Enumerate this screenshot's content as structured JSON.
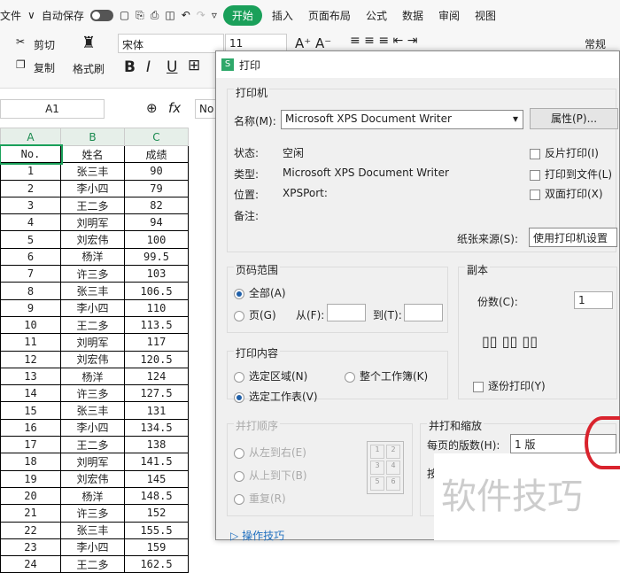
{
  "menubar": {
    "file": "文件",
    "autosave": "自动保存",
    "tabs": [
      "开始",
      "插入",
      "页面布局",
      "公式",
      "数据",
      "审阅",
      "视图"
    ]
  },
  "ribbon": {
    "cut": "剪切",
    "copy": "复制",
    "format_painter": "格式刷",
    "font": "宋体",
    "font_size": "11",
    "number_format": "常规"
  },
  "formula": {
    "cell_ref": "A1",
    "fx": "fx",
    "value": "No"
  },
  "sheet": {
    "columns": [
      "A",
      "B",
      "C"
    ],
    "rows": [
      [
        "No.",
        "姓名",
        "成绩"
      ],
      [
        "1",
        "张三丰",
        "90"
      ],
      [
        "2",
        "李小四",
        "79"
      ],
      [
        "3",
        "王二多",
        "82"
      ],
      [
        "4",
        "刘明军",
        "94"
      ],
      [
        "5",
        "刘宏伟",
        "100"
      ],
      [
        "6",
        "杨洋",
        "99.5"
      ],
      [
        "7",
        "许三多",
        "103"
      ],
      [
        "8",
        "张三丰",
        "106.5"
      ],
      [
        "9",
        "李小四",
        "110"
      ],
      [
        "10",
        "王二多",
        "113.5"
      ],
      [
        "11",
        "刘明军",
        "117"
      ],
      [
        "12",
        "刘宏伟",
        "120.5"
      ],
      [
        "13",
        "杨洋",
        "124"
      ],
      [
        "14",
        "许三多",
        "127.5"
      ],
      [
        "15",
        "张三丰",
        "131"
      ],
      [
        "16",
        "李小四",
        "134.5"
      ],
      [
        "17",
        "王二多",
        "138"
      ],
      [
        "18",
        "刘明军",
        "141.5"
      ],
      [
        "19",
        "刘宏伟",
        "145"
      ],
      [
        "20",
        "杨洋",
        "148.5"
      ],
      [
        "21",
        "许三多",
        "152"
      ],
      [
        "22",
        "张三丰",
        "155.5"
      ],
      [
        "23",
        "李小四",
        "159"
      ],
      [
        "24",
        "王二多",
        "162.5"
      ]
    ]
  },
  "dialog": {
    "title": "打印",
    "printer": {
      "legend": "打印机",
      "name_label": "名称(M):",
      "name_value": "Microsoft XPS Document Writer",
      "properties": "属性(P)...",
      "status_label": "状态:",
      "status_value": "空闲",
      "type_label": "类型:",
      "type_value": "Microsoft XPS Document Writer",
      "location_label": "位置:",
      "location_value": "XPSPort:",
      "comment_label": "备注:",
      "reverse": "反片打印(I)",
      "to_file": "打印到文件(L)",
      "duplex": "双面打印(X)",
      "paper_source_label": "纸张来源(S):",
      "paper_source_value": "使用打印机设置"
    },
    "range": {
      "legend": "页码范围",
      "all": "全部(A)",
      "pages": "页(G)",
      "from": "从(F):",
      "to": "到(T):"
    },
    "copies": {
      "legend": "副本",
      "count_label": "份数(C):",
      "count_value": "1",
      "collate": "逐份打印(Y)"
    },
    "content": {
      "legend": "打印内容",
      "selection": "选定区域(N)",
      "workbook": "整个工作簿(K)",
      "sheet": "选定工作表(V)"
    },
    "order": {
      "legend": "并打顺序",
      "ltr": "从左到右(E)",
      "ttb": "从上到下(B)",
      "repeat": "重复(R)",
      "grid": [
        "1",
        "2",
        "3",
        "4",
        "5",
        "6"
      ]
    },
    "scale": {
      "legend": "并打和缩放",
      "per_page_label": "每页的版数(H):",
      "per_page_value": "1 版",
      "by_label": "按"
    },
    "tips": "操作技巧"
  },
  "watermark": "软件技巧"
}
